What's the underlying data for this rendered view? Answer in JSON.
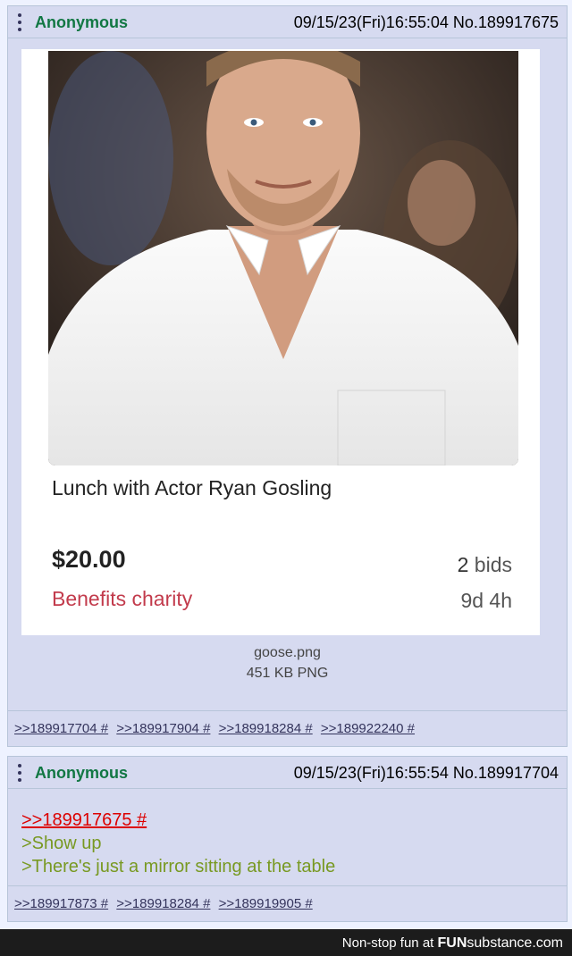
{
  "post1": {
    "name": "Anonymous",
    "date": "09/15/23(Fri)16:55:04",
    "number": "No.189917675",
    "image": {
      "listing_title": "Lunch with Actor Ryan Gosling",
      "price": "$20.00",
      "charity": "Benefits charity",
      "bids_count": "2",
      "bids_label": "bids",
      "time_left": "9d 4h"
    },
    "file_name": "goose.png",
    "file_size": "451 KB PNG",
    "backlinks": [
      ">>189917704 #",
      ">>189917904 #",
      ">>189918284 #",
      ">>189922240 #"
    ]
  },
  "post2": {
    "name": "Anonymous",
    "date": "09/15/23(Fri)16:55:54",
    "number": "No.189917704",
    "quote_link": ">>189917675 #",
    "greentext": [
      ">Show up",
      ">There's just a mirror sitting at the table"
    ],
    "backlinks": [
      ">>189917873 #",
      ">>189918284 #",
      ">>189919905 #"
    ]
  },
  "footer": {
    "text": "Non-stop fun at",
    "brand_fun": "FUN",
    "brand_rest": "substance",
    "brand_tld": ".com"
  },
  "colors": {
    "name_green": "#117743",
    "greentext": "#789922",
    "quote_red": "#dd0000",
    "post_bg": "#d6daf0",
    "charity_red": "#c23b4c"
  }
}
